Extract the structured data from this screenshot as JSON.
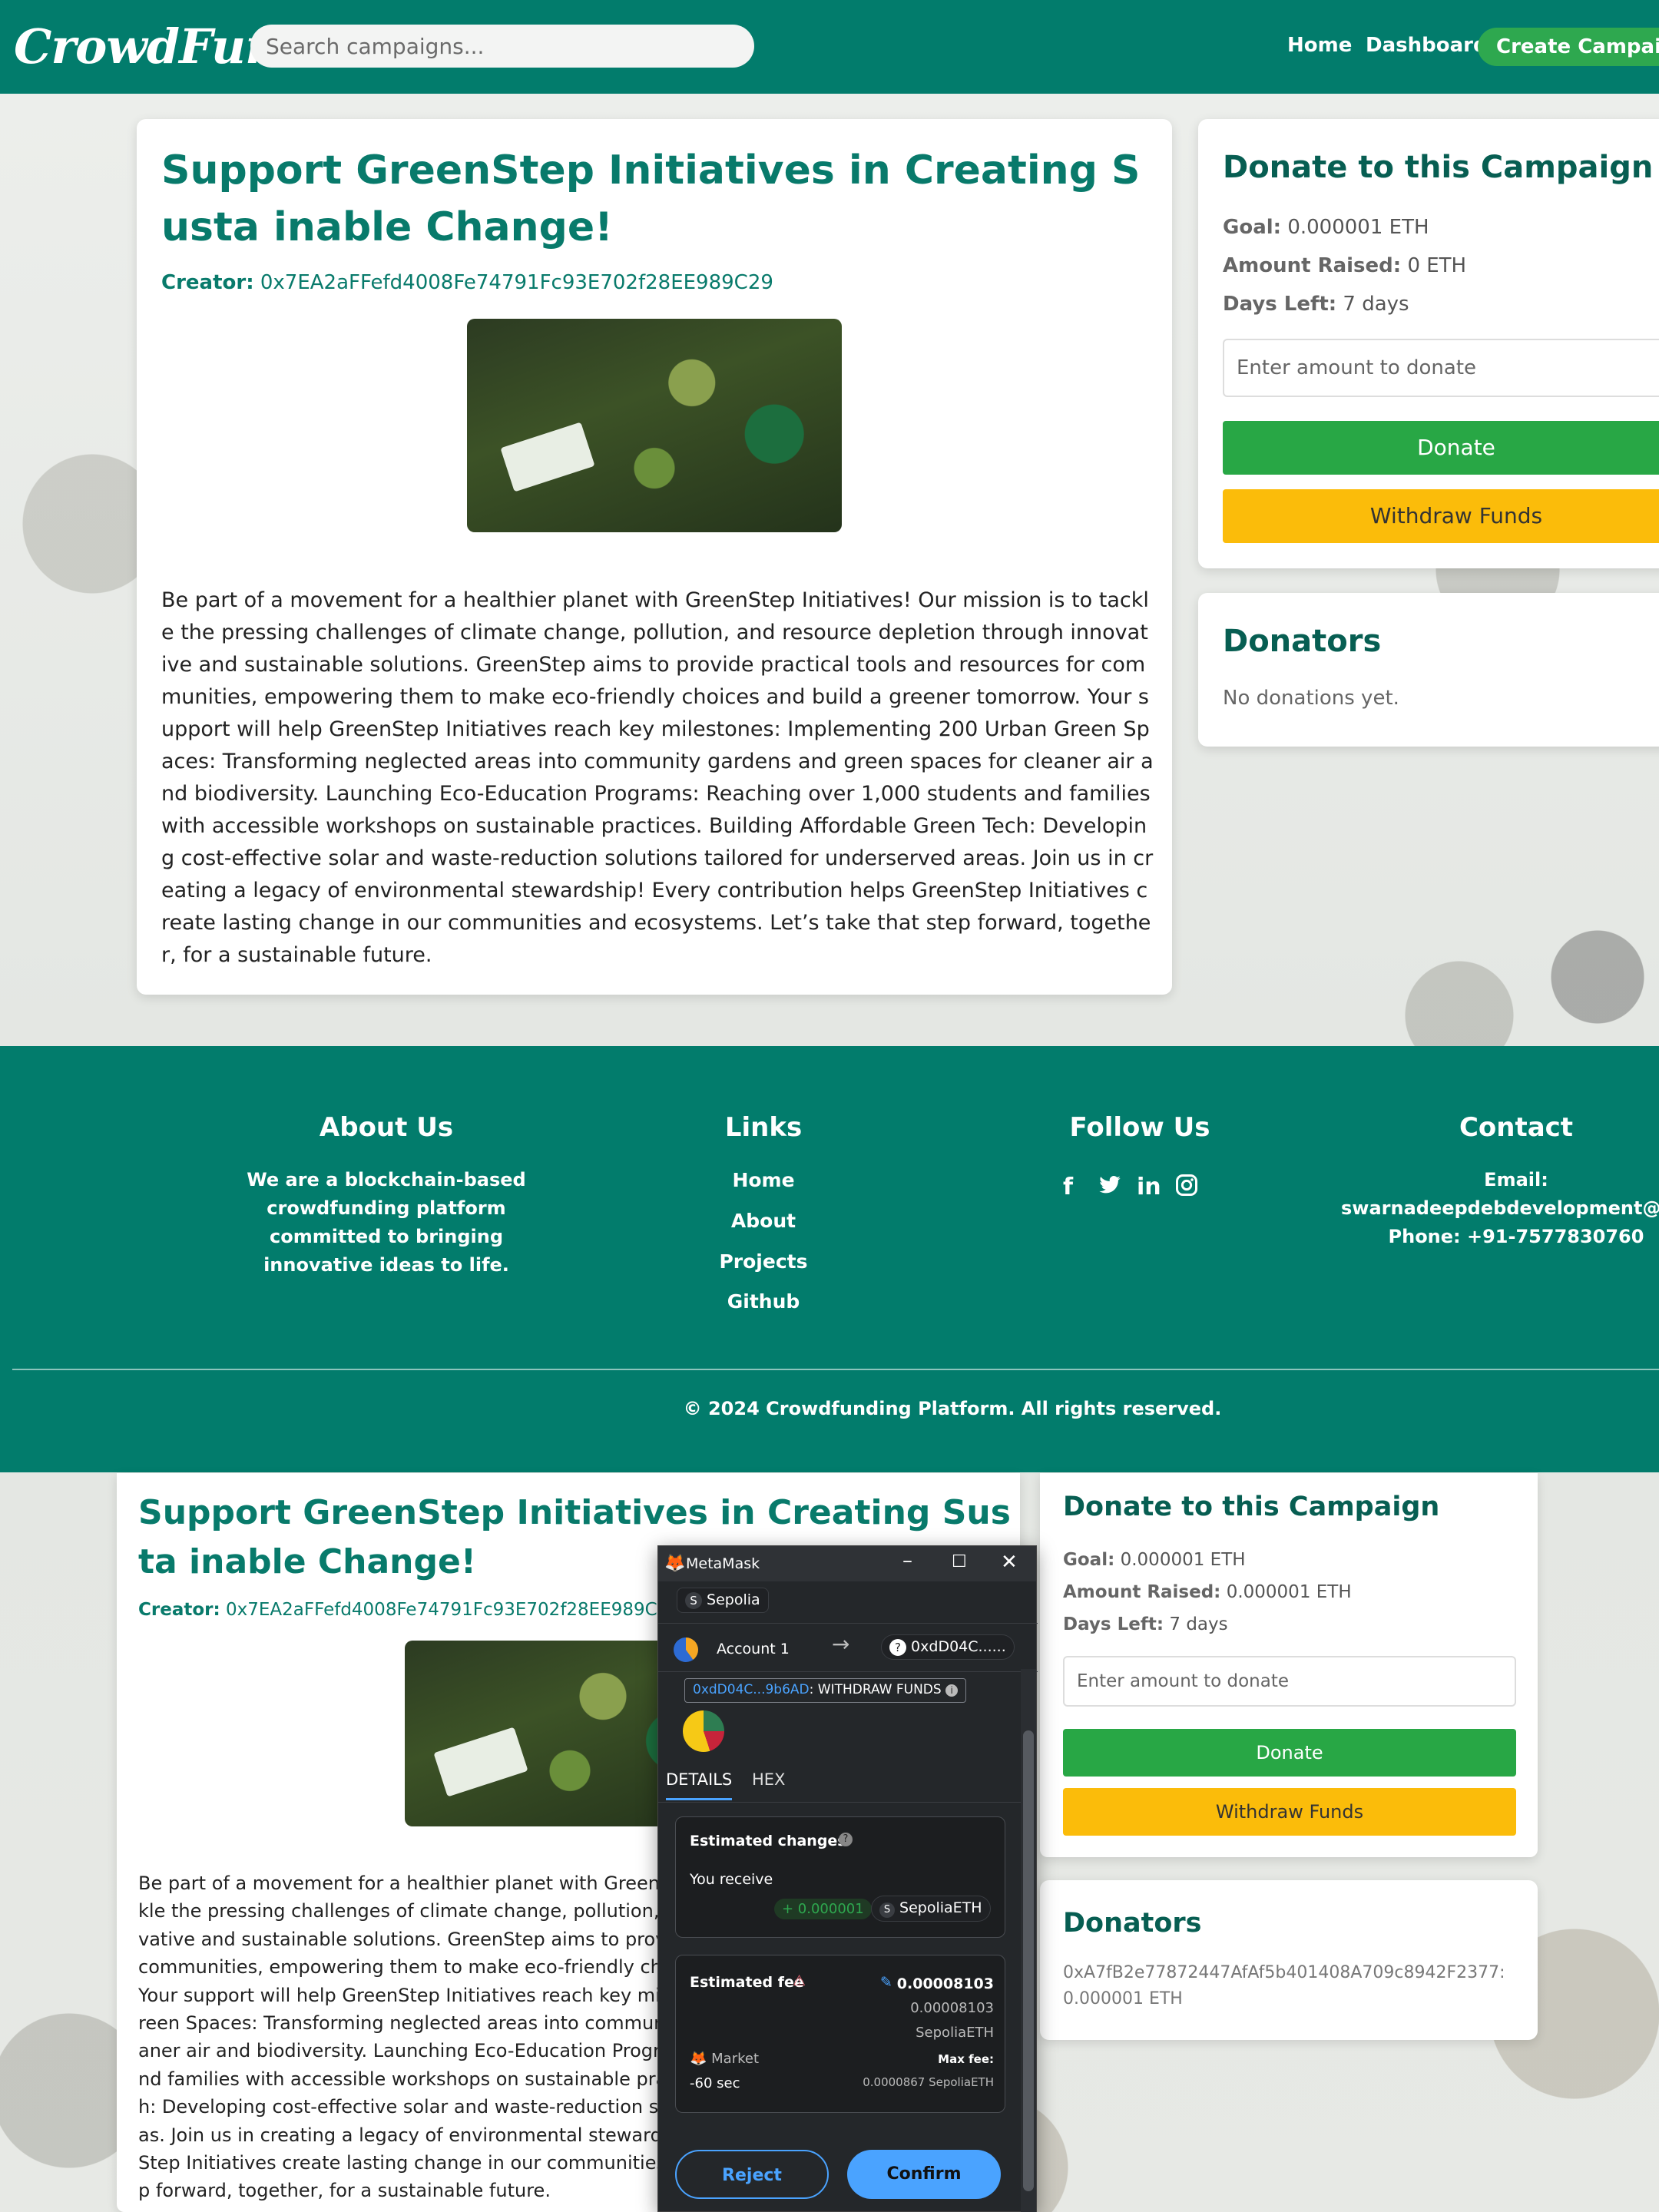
{
  "header": {
    "logo": "CrowdFund",
    "search_placeholder": "Search campaigns...",
    "nav": [
      "Home",
      "Dashboard"
    ],
    "create_label": "Create Campaign",
    "brand_color": "#027c6c",
    "accent_color": "#2ea84f"
  },
  "campaign": {
    "title": "Support GreenStep Initiatives in Creating Susta inable Change!",
    "creator_label": "Creator:",
    "creator_address": "0x7EA2aFFefd4008Fe74791Fc93E702f28EE989C29",
    "description": "Be part of a movement for a healthier planet with GreenStep Initiatives! Our mission is to tackle the pressing challenges of climate change, pollution, and resource depletion through innovative and sustainable solutions. GreenStep aims to provide practical tools and resources for communities, empowering them to make eco-friendly choices and build a greener tomorrow. Your support will help GreenStep Initiatives reach key milestones: Implementing 200 Urban Green Spaces: Transforming neglected areas into community gardens and green spaces for cleaner air and biodiversity. Launching Eco-Education Programs: Reaching over 1,000 students and families with accessible workshops on sustainable practices. Building Affordable Green Tech: Developing cost-effective solar and waste-reduction solutions tailored for underserved areas. Join us in creating a legacy of environmental stewardship! Every contribution helps GreenStep Initiatives create lasting change in our communities and ecosystems. Let’s take that step forward, together, for a sustainable future."
  },
  "donate_panel": {
    "title": "Donate to this Campaign",
    "goal_label": "Goal:",
    "goal_value": "0.000001 ETH",
    "raised_label": "Amount Raised:",
    "raised_value": "0 ETH",
    "days_label": "Days Left:",
    "days_value": "7 days",
    "amount_placeholder": "Enter amount to donate",
    "donate_label": "Donate",
    "withdraw_label": "Withdraw Funds"
  },
  "donators_panel": {
    "title": "Donators",
    "empty_text": "No donations yet."
  },
  "footer": {
    "about_title": "About Us",
    "about_text": "We are a blockchain-based crowdfunding platform committed to bringing innovative ideas to life.",
    "links_title": "Links",
    "links": [
      "Home",
      "About",
      "Projects",
      "Github"
    ],
    "follow_title": "Follow Us",
    "social_icons": [
      "facebook-icon",
      "twitter-icon",
      "linkedin-icon",
      "instagram-icon"
    ],
    "contact_title": "Contact",
    "contact_email_label": "Email:",
    "contact_email": "swarnadeepdebdevelopment@gmc",
    "contact_phone": "Phone: +91-7577830760",
    "copyright": "© 2024 Crowdfunding Platform. All rights reserved."
  },
  "second_view": {
    "raised_value": "0.000001 ETH",
    "donator_entry": "0xA7fB2e77872447AfAf5b401408A709c8942F2377: 0.000001 ETH"
  },
  "metamask": {
    "window_title": "MetaMask",
    "network": "Sepolia",
    "account": "Account 1",
    "to_address": "0xdD04C......",
    "contract_call": "0xdD04C...9b6AD",
    "method": ": WITHDRAW FUNDS",
    "tab_details": "DETAILS",
    "tab_hex": "HEX",
    "est_changes_title": "Estimated changes",
    "you_receive": "You receive",
    "receive_amount": "+ 0.000001",
    "receive_token": "SepoliaETH",
    "est_fee_title": "Estimated fee",
    "fee_value": "0.00008103",
    "fee_secondary": "0.00008103",
    "fee_token": "SepoliaETH",
    "market_label": "Market",
    "time_label": "-60 sec",
    "max_fee_label": "Max fee:",
    "max_fee_value": "0.0000867 SepoliaETH",
    "reject_label": "Reject",
    "confirm_label": "Confirm"
  }
}
